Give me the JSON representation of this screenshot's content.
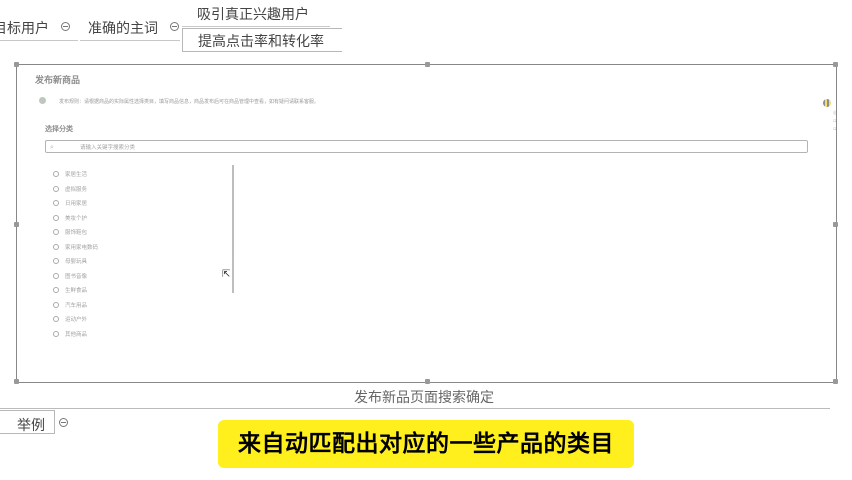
{
  "mindmap": {
    "node_target": "目标用户",
    "node_precise": "准确的主词",
    "node_attract": "吸引真正兴趣用户",
    "node_improve": "提高点击率和转化率",
    "node_example": "举例",
    "frame_caption": "发布新品页面搜索确定"
  },
  "screenshot": {
    "title": "发布新商品",
    "notice": "发布规则：请根据商品的实际属性选择类目，填写商品信息，商品发布后可在商品管理中查看，如有疑问请联系客服。",
    "section_label": "选择分类",
    "search_placeholder": "请输入关键字搜索分类",
    "categories": [
      "家居生活",
      "虚拟服务",
      "日用家居",
      "美妆个护",
      "服饰鞋包",
      "家用家电数码",
      "母婴玩具",
      "图书音像",
      "生鲜食品",
      "汽车用品",
      "运动户外",
      "其他商品"
    ]
  },
  "subtitle": "来自动匹配出对应的一些产品的类目"
}
